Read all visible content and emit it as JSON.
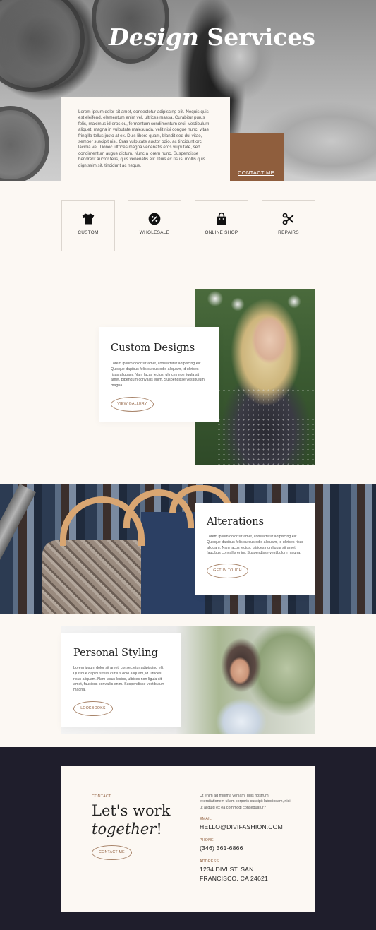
{
  "hero": {
    "title_italic": "Design",
    "title_rest": " Services",
    "body": "Lorem ipsum dolor sit amet, consectetur adipiscing elit. Nequis quis est eleifend, elementum enim vel, ultrices massa. Curabitur purus felis, maximus id eros eu, fermentum condimentum orci. Vestibulum aliquet, magna in vulputate malesuada, velit nisi congue nunc, vitae fringilla tellus justo at ex. Duis libero quam, blandit sed dui vitae, semper suscipit nisi. Cras vulputate auctor odio, ac tincidunt orci lacinia vel. Donec ultrices magna venenatis eros vulputate, sed condimentum augue dictum. Nunc a lorem nunc. Suspendisse hendrerit auctor felis, quis venenatis elit. Duis ex risus, mollis quis dignissim sit, tincidunt ac neque.",
    "cta": "CONTACT ME"
  },
  "services": [
    {
      "label": "CUSTOM",
      "icon": "tshirt-icon"
    },
    {
      "label": "WHOLESALE",
      "icon": "percent-icon"
    },
    {
      "label": "ONLINE SHOP",
      "icon": "shopping-bag-icon"
    },
    {
      "label": "REPAIRS",
      "icon": "scissors-icon"
    }
  ],
  "custom_designs": {
    "title": "Custom Designs",
    "body": "Lorem ipsum dolor sit amet, consectetur adipiscing elit. Quisque dapibus felis cursus odio aliquam, id ultrices risus aliquam. Nam lacus lectus, ultrices non ligula sit amet, bibendum convallis enim. Suspendisse vestibulum magna.",
    "button": "VIEW GALLERY"
  },
  "alterations": {
    "title": "Alterations",
    "body": "Lorem ipsum dolor sit amet, consectetur adipiscing elit. Quisque dapibus felis cursus odio aliquam, id ultrices risus aliquam. Nam lacus lectus, ultrices non ligula sit amet, faucibus convallis enim. Suspendisse vestibulum magna.",
    "button": "GET IN TOUCH"
  },
  "personal_styling": {
    "title": "Personal Styling",
    "body": "Lorem ipsum dolor sit amet, consectetur adipiscing elit. Quisque dapibus felis cursus odio aliquam, id ultrices risus aliquam. Nam lacus lectus, ultrices non ligula sit amet, faucibus convallis enim. Suspendisse vestibulum magna.",
    "button": "LOOKBOOKS"
  },
  "contact": {
    "eyebrow": "CONTACT",
    "heading_line1": "Let's work",
    "heading_italic": "together",
    "heading_end": "!",
    "button": "CONTACT ME",
    "intro": "Ut enim ad minima veniam, quis nostrum exercitationem ullam corporis suscipit laboriosam, nisi ut aliquid ex ea commodi consequatur?",
    "email_label": "EMAIL",
    "email": "HELLO@DIVIFASHION.COM",
    "phone_label": "PHONE",
    "phone": "(346) 361-6866",
    "address_label": "ADDRESS",
    "address_line1": "1234 DIVI ST. SAN",
    "address_line2": "FRANCISCO, CA 24621"
  },
  "colors": {
    "cream": "#fcf8f3",
    "brown_accent": "#8f5e3d",
    "dark_navy": "#1f1e2c"
  }
}
